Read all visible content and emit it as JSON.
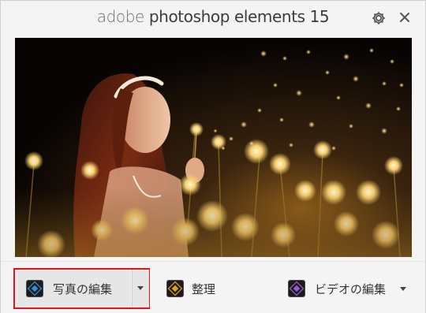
{
  "window": {
    "title_brand": "adobe",
    "title_product": "photoshop elements 15"
  },
  "toolbar": {
    "settings_icon": "gear-icon",
    "close_label": "×"
  },
  "hero": {
    "alt_description": "",
    "accent_color": "#f2b33d"
  },
  "launcher": {
    "photo_editor_label": "写真の編集",
    "organizer_label": "整理",
    "video_editor_label": "ビデオの編集",
    "selected": "photo_editor",
    "highlight_color": "#e0141c"
  }
}
